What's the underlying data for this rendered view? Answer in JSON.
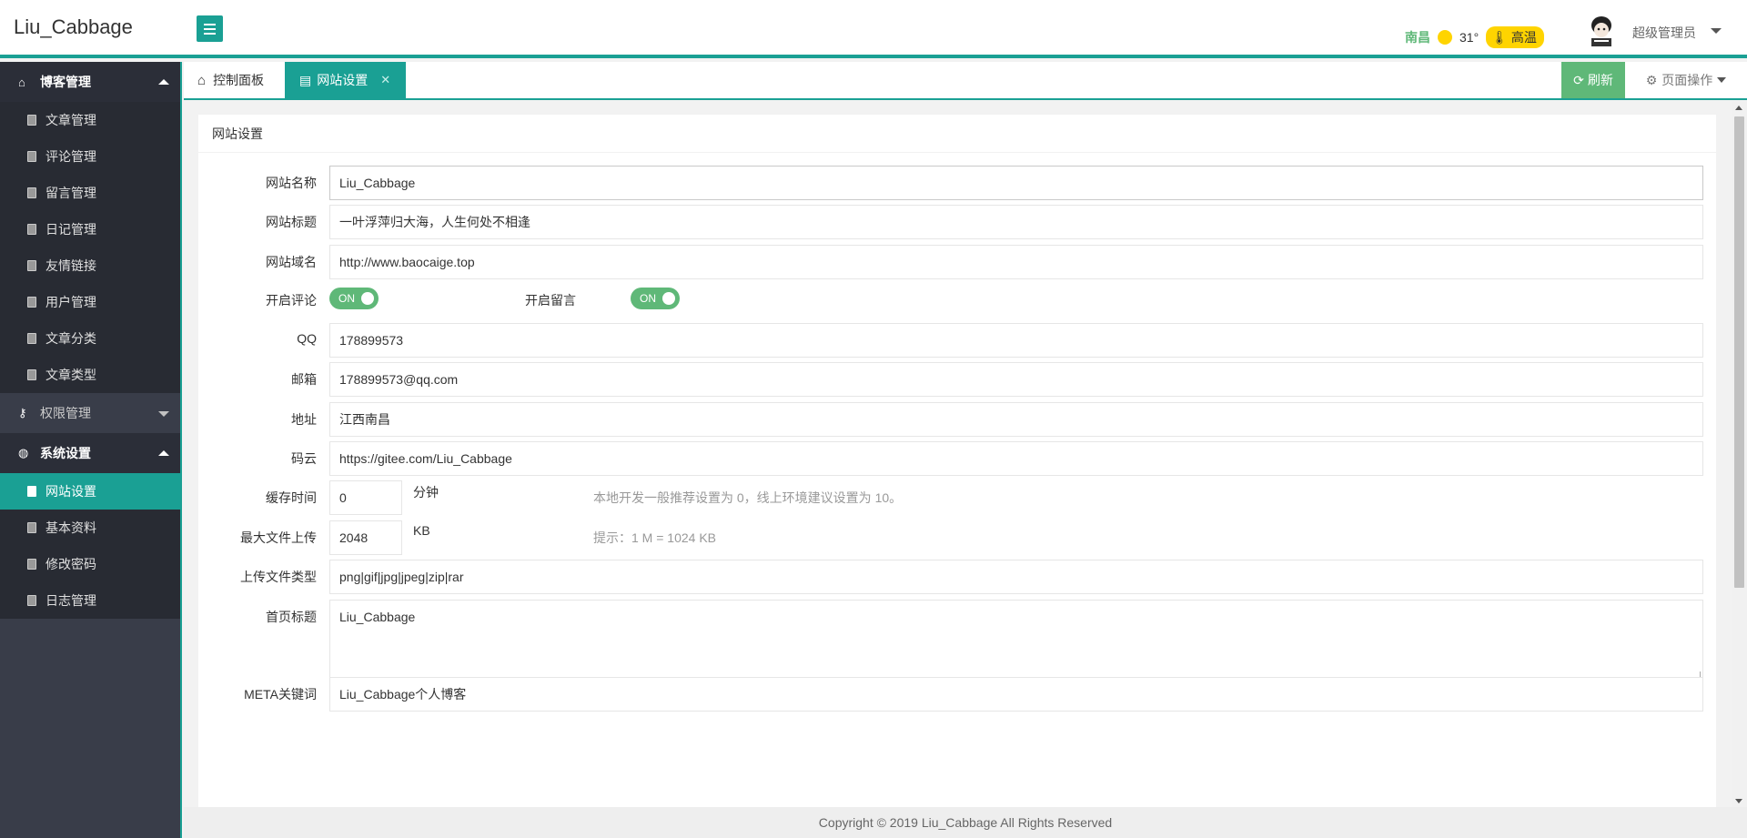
{
  "header": {
    "logo": "Liu_Cabbage",
    "weather": {
      "city": "南昌",
      "temp": "31°",
      "badge": "高温"
    },
    "user_name": "超级管理员"
  },
  "sidebar": {
    "groups": [
      {
        "label": "博客管理",
        "icon": "home-icon",
        "expanded": true,
        "items": [
          "文章管理",
          "评论管理",
          "留言管理",
          "日记管理",
          "友情链接",
          "用户管理",
          "文章分类",
          "文章类型"
        ]
      },
      {
        "label": "权限管理",
        "icon": "key-icon",
        "expanded": false,
        "items": []
      },
      {
        "label": "系统设置",
        "icon": "globe-icon",
        "expanded": true,
        "items": [
          "网站设置",
          "基本资料",
          "修改密码",
          "日志管理"
        ],
        "active": "网站设置"
      }
    ]
  },
  "tabs": {
    "home": "控制面板",
    "site": "网站设置",
    "refresh": "刷新",
    "page_ops": "页面操作"
  },
  "panel": {
    "title": "网站设置",
    "fields": {
      "site_name": {
        "label": "网站名称",
        "value": "Liu_Cabbage"
      },
      "site_title": {
        "label": "网站标题",
        "value": "一叶浮萍归大海，人生何处不相逢"
      },
      "site_domain": {
        "label": "网站域名",
        "value": "http://www.baocaige.top"
      },
      "enable_comment": {
        "label": "开启评论",
        "value": "ON"
      },
      "enable_message": {
        "label": "开启留言",
        "value": "ON"
      },
      "qq": {
        "label": "QQ",
        "value": "178899573"
      },
      "email": {
        "label": "邮箱",
        "value": "178899573@qq.com"
      },
      "address": {
        "label": "地址",
        "value": "江西南昌"
      },
      "gitee": {
        "label": "码云",
        "value": "https://gitee.com/Liu_Cabbage"
      },
      "cache_time": {
        "label": "缓存时间",
        "value": "0",
        "unit": "分钟",
        "hint": "本地开发一般推荐设置为 0，线上环境建议设置为 10。"
      },
      "max_upload": {
        "label": "最大文件上传",
        "value": "2048",
        "unit": "KB",
        "hint": "提示：1 M = 1024 KB"
      },
      "upload_types": {
        "label": "上传文件类型",
        "value": "png|gif|jpg|jpeg|zip|rar"
      },
      "home_title": {
        "label": "首页标题",
        "value": "Liu_Cabbage"
      },
      "meta_keywords": {
        "label": "META关键词",
        "value": "Liu_Cabbage个人博客"
      }
    }
  },
  "footer": {
    "copyright": "Copyright © 2019 Liu_Cabbage All Rights Reserved"
  },
  "colors": {
    "accent": "#1aa094",
    "switch_on": "#5fb878",
    "sidebar_bg": "#393d49",
    "badge": "#ffd400"
  }
}
